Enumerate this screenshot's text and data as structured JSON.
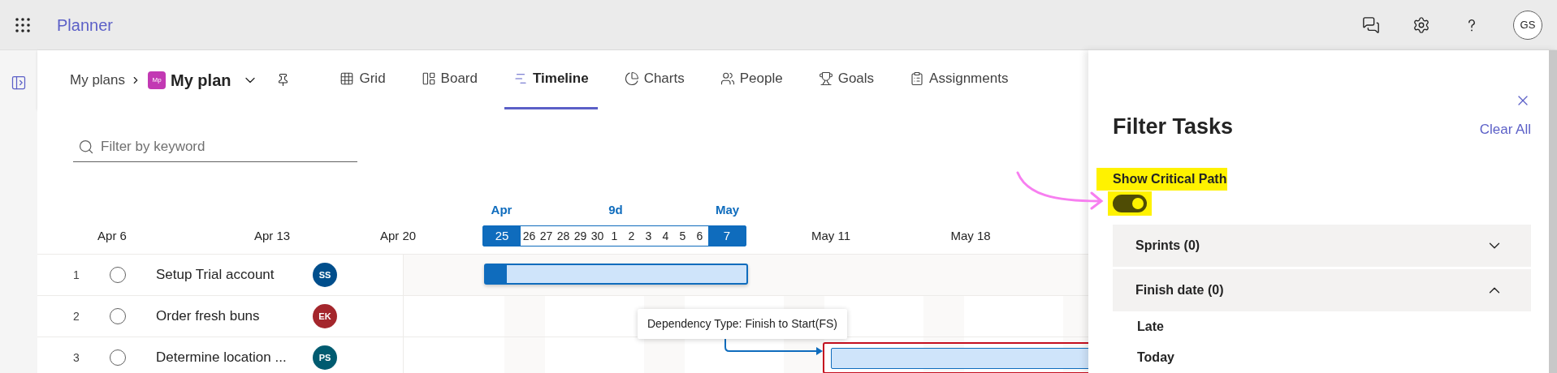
{
  "app": {
    "name": "Planner",
    "avatar": "GS"
  },
  "breadcrumb": {
    "parent": "My plans",
    "plan_icon": "Mp",
    "plan": "My plan"
  },
  "tabs": [
    {
      "label": "Grid",
      "selected": false
    },
    {
      "label": "Board",
      "selected": false
    },
    {
      "label": "Timeline",
      "selected": true
    },
    {
      "label": "Charts",
      "selected": false
    },
    {
      "label": "People",
      "selected": false
    },
    {
      "label": "Goals",
      "selected": false
    },
    {
      "label": "Assignments",
      "selected": false
    }
  ],
  "filter": {
    "placeholder": "Filter by keyword"
  },
  "timeline": {
    "range_start_month": "Apr",
    "range_duration": "9d",
    "range_end_month": "May",
    "range_start_day": "25",
    "range_days": [
      "26",
      "27",
      "28",
      "29",
      "30",
      "1",
      "2",
      "3",
      "4",
      "5",
      "6"
    ],
    "range_end_day": "7",
    "weeks_before": [
      "Apr 6",
      "Apr 13",
      "Apr 20"
    ],
    "weeks_after": [
      "May 11",
      "May 18"
    ]
  },
  "tasks": [
    {
      "number": "1",
      "name": "Setup Trial account",
      "completed": false,
      "assignee": "SS",
      "color": "#004e8c",
      "bar": {
        "level": 0.08,
        "critical": false
      }
    },
    {
      "number": "2",
      "name": "Order fresh buns",
      "completed": false,
      "assignee": "EK",
      "color": "#a4262c"
    },
    {
      "number": "3",
      "name": "Determine location ...",
      "completed": false,
      "assignee": "PS",
      "color": "#005b70",
      "bar": {
        "critical": true
      }
    }
  ],
  "tooltip": "Dependency Type: Finish to Start(FS)",
  "filter_panel": {
    "title": "Filter Tasks",
    "clear": "Clear All",
    "critical_path": {
      "label": "Show Critical Path",
      "on": true
    },
    "sections": [
      {
        "label": "Sprints (0)",
        "expanded": false
      },
      {
        "label": "Finish date (0)",
        "expanded": true,
        "options": [
          "Late",
          "Today"
        ]
      }
    ]
  }
}
